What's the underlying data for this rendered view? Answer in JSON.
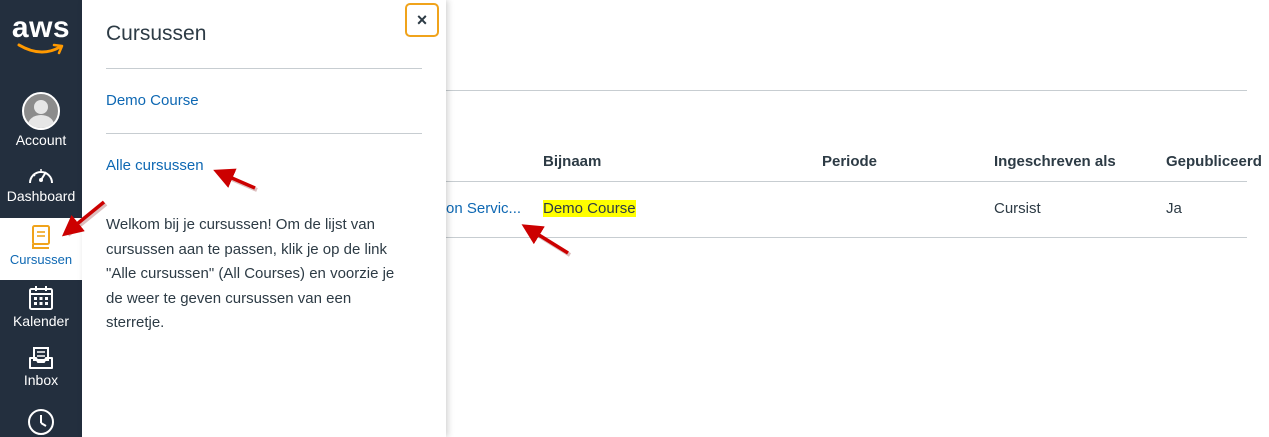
{
  "nav": {
    "logo_text": "aws",
    "items": [
      {
        "label": "Account",
        "icon": "avatar"
      },
      {
        "label": "Dashboard",
        "icon": "dashboard-icon"
      },
      {
        "label": "Cursussen",
        "icon": "courses-icon",
        "active": true
      },
      {
        "label": "Kalender",
        "icon": "calendar-icon"
      },
      {
        "label": "Inbox",
        "icon": "inbox-icon"
      },
      {
        "label": "",
        "icon": "history-icon"
      }
    ]
  },
  "tray": {
    "title": "Cursussen",
    "close_label": "×",
    "course_link": "Demo Course",
    "all_courses_link": "Alle cursussen",
    "help_text": "Welkom bij je cursussen! Om de lijst van cursussen aan te passen, klik je op de link \"Alle cursussen\" (All Courses) en voorzie je de weer te geven cursussen van een sterretje."
  },
  "table": {
    "headers": [
      "Bijnaam",
      "Periode",
      "Ingeschreven als",
      "Gepubliceerd"
    ],
    "row": {
      "course_truncated": "on Servic...",
      "nickname": "Demo Course",
      "term": "",
      "enrolled_as": "Cursist",
      "published": "Ja"
    }
  },
  "colors": {
    "nav_bg": "#232f3e",
    "link": "#0e68b3",
    "aws_orange": "#ff9900",
    "close_border": "#f0a31b",
    "highlight": "#ffff00",
    "annotation_arrow": "#cc0000"
  }
}
